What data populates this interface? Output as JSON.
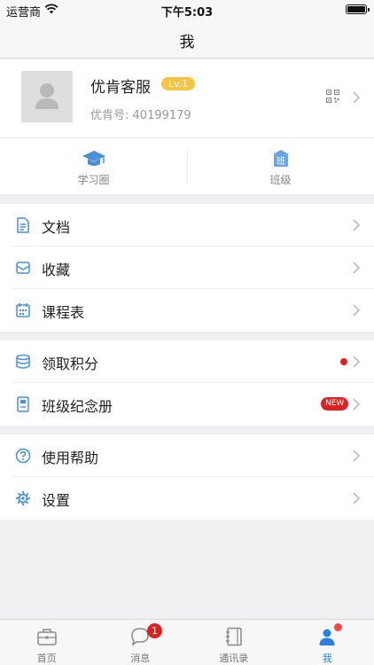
{
  "status_bar": {
    "carrier": "运营商",
    "time": "下午5:03"
  },
  "nav": {
    "title": "我"
  },
  "profile": {
    "name": "优肯客服",
    "level": "Lv.1",
    "id_label": "优肯号:",
    "id_value": "40199179"
  },
  "quick_actions": [
    {
      "label": "学习圈",
      "icon": "graduation-cap-icon"
    },
    {
      "label": "班级",
      "icon": "class-icon",
      "glyph": "班"
    }
  ],
  "menu_groups": [
    [
      {
        "label": "文档",
        "icon": "document-icon"
      },
      {
        "label": "收藏",
        "icon": "favorites-icon"
      },
      {
        "label": "课程表",
        "icon": "calendar-icon"
      }
    ],
    [
      {
        "label": "领取积分",
        "icon": "points-icon",
        "has_dot": true
      },
      {
        "label": "班级纪念册",
        "icon": "album-icon",
        "badge": "NEW"
      }
    ],
    [
      {
        "label": "使用帮助",
        "icon": "help-icon"
      },
      {
        "label": "设置",
        "icon": "gear-icon"
      }
    ]
  ],
  "tab_bar": {
    "tabs": [
      {
        "label": "首页",
        "icon": "home-briefcase-icon"
      },
      {
        "label": "消息",
        "icon": "message-bubble-icon",
        "badge": "1"
      },
      {
        "label": "通讯录",
        "icon": "contacts-book-icon"
      },
      {
        "label": "我",
        "icon": "person-icon",
        "active": true
      }
    ]
  },
  "colors": {
    "accent": "#2a7fe0",
    "icon_blue": "#4a90d9",
    "badge_red": "#e02020",
    "level_yellow": "#f6c445",
    "background": "#f0f0f2"
  }
}
